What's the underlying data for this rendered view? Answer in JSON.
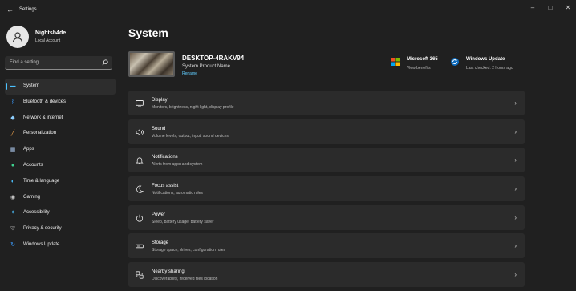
{
  "window": {
    "title": "Settings",
    "back_glyph": "←",
    "minimize_glyph": "–",
    "maximize_glyph": "□",
    "close_glyph": "✕"
  },
  "user": {
    "name": "Nightsh4de",
    "account": "Local Account"
  },
  "search": {
    "placeholder": "Find a setting",
    "icon": "search-icon"
  },
  "nav": {
    "items": [
      {
        "label": "System",
        "icon": "system-icon",
        "color": "#4cc2ff",
        "active": true
      },
      {
        "label": "Bluetooth & devices",
        "icon": "bluetooth-icon",
        "color": "#3b9cff"
      },
      {
        "label": "Network & internet",
        "icon": "network-icon",
        "color": "#8ecfff"
      },
      {
        "label": "Personalization",
        "icon": "brush-icon",
        "color": "#f3a54c"
      },
      {
        "label": "Apps",
        "icon": "apps-icon",
        "color": "#a9c4e8"
      },
      {
        "label": "Accounts",
        "icon": "accounts-icon",
        "color": "#3ecf8e"
      },
      {
        "label": "Time & language",
        "icon": "globe-icon",
        "color": "#4cc2ff"
      },
      {
        "label": "Gaming",
        "icon": "gaming-icon",
        "color": "#c0c0c0"
      },
      {
        "label": "Accessibility",
        "icon": "accessibility-icon",
        "color": "#4cc2ff"
      },
      {
        "label": "Privacy & security",
        "icon": "shield-icon",
        "color": "#a0a0a0"
      },
      {
        "label": "Windows Update",
        "icon": "update-icon",
        "color": "#3b9cff"
      }
    ]
  },
  "page": {
    "title": "System"
  },
  "device": {
    "name": "DESKTOP-4RAKV94",
    "product": "System Product Name",
    "rename": "Rename"
  },
  "tiles": {
    "m365": {
      "title": "Microsoft 365",
      "subtitle": "View benefits",
      "icon": "microsoft-365-icon"
    },
    "update": {
      "title": "Windows Update",
      "subtitle": "Last checked: 2 hours ago",
      "icon": "windows-update-icon"
    }
  },
  "cards": [
    {
      "title": "Display",
      "subtitle": "Monitors, brightness, night light, display profile",
      "icon": "display-icon"
    },
    {
      "title": "Sound",
      "subtitle": "Volume levels, output, input, sound devices",
      "icon": "sound-icon"
    },
    {
      "title": "Notifications",
      "subtitle": "Alerts from apps and system",
      "icon": "notifications-icon"
    },
    {
      "title": "Focus assist",
      "subtitle": "Notifications, automatic rules",
      "icon": "focus-assist-icon"
    },
    {
      "title": "Power",
      "subtitle": "Sleep, battery usage, battery saver",
      "icon": "power-icon"
    },
    {
      "title": "Storage",
      "subtitle": "Storage space, drives, configuration rules",
      "icon": "storage-icon"
    },
    {
      "title": "Nearby sharing",
      "subtitle": "Discoverability, received files location",
      "icon": "nearby-sharing-icon"
    }
  ],
  "chevron": "›"
}
